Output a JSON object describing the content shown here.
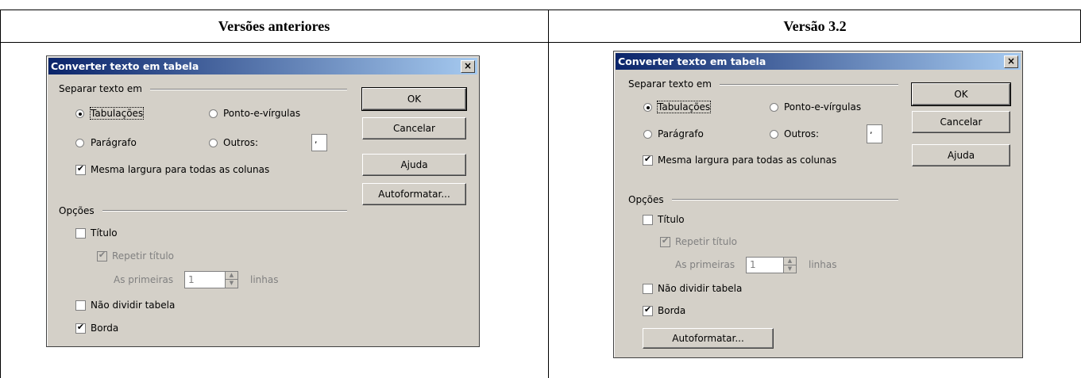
{
  "columns": {
    "left_heading": "Versões anteriores",
    "right_heading": "Versão 3.2"
  },
  "dialog_left": {
    "title": "Converter texto em tabela",
    "close_label": "×",
    "group_separate": "Separar texto em",
    "radio_tabs": "Tabulações",
    "radio_semicolons": "Ponto-e-vírgulas",
    "radio_paragraph": "Parágrafo",
    "radio_others": "Outros:",
    "others_value": ",",
    "check_same_width": "Mesma largura para todas as colunas",
    "group_options": "Opções",
    "check_title": "Título",
    "check_repeat_title": "Repetir título",
    "first_label": "As primeiras",
    "first_value": "1",
    "lines_label": "linhas",
    "check_no_split": "Não dividir tabela",
    "check_border": "Borda",
    "btn_ok": "OK",
    "btn_cancel": "Cancelar",
    "btn_help": "Ajuda",
    "btn_autoformat": "Autoformatar..."
  },
  "dialog_right": {
    "title": "Converter texto em tabela",
    "close_label": "×",
    "group_separate": "Separar texto em",
    "radio_tabs": "Tabulações",
    "radio_semicolons": "Ponto-e-vírgulas",
    "radio_paragraph": "Parágrafo",
    "radio_others": "Outros:",
    "others_value": ",",
    "check_same_width": "Mesma largura para todas as colunas",
    "group_options": "Opções",
    "check_title": "Título",
    "check_repeat_title": "Repetir título",
    "first_label": "As primeiras",
    "first_value": "1",
    "lines_label": "linhas",
    "check_no_split": "Não dividir tabela",
    "check_border": "Borda",
    "btn_ok": "OK",
    "btn_cancel": "Cancelar",
    "btn_help": "Ajuda",
    "btn_autoformat": "Autoformatar..."
  },
  "state": {
    "selected_separator": "Tabulações",
    "same_width_checked": true,
    "title_checked": false,
    "repeat_title_checked": true,
    "repeat_title_disabled": true,
    "no_split_checked": false,
    "border_checked": true
  },
  "colors": {
    "dialog_face": "#d4d0c8",
    "titlebar_start": "#0a246a",
    "titlebar_end": "#a6caf0",
    "disabled_text": "#808080"
  }
}
